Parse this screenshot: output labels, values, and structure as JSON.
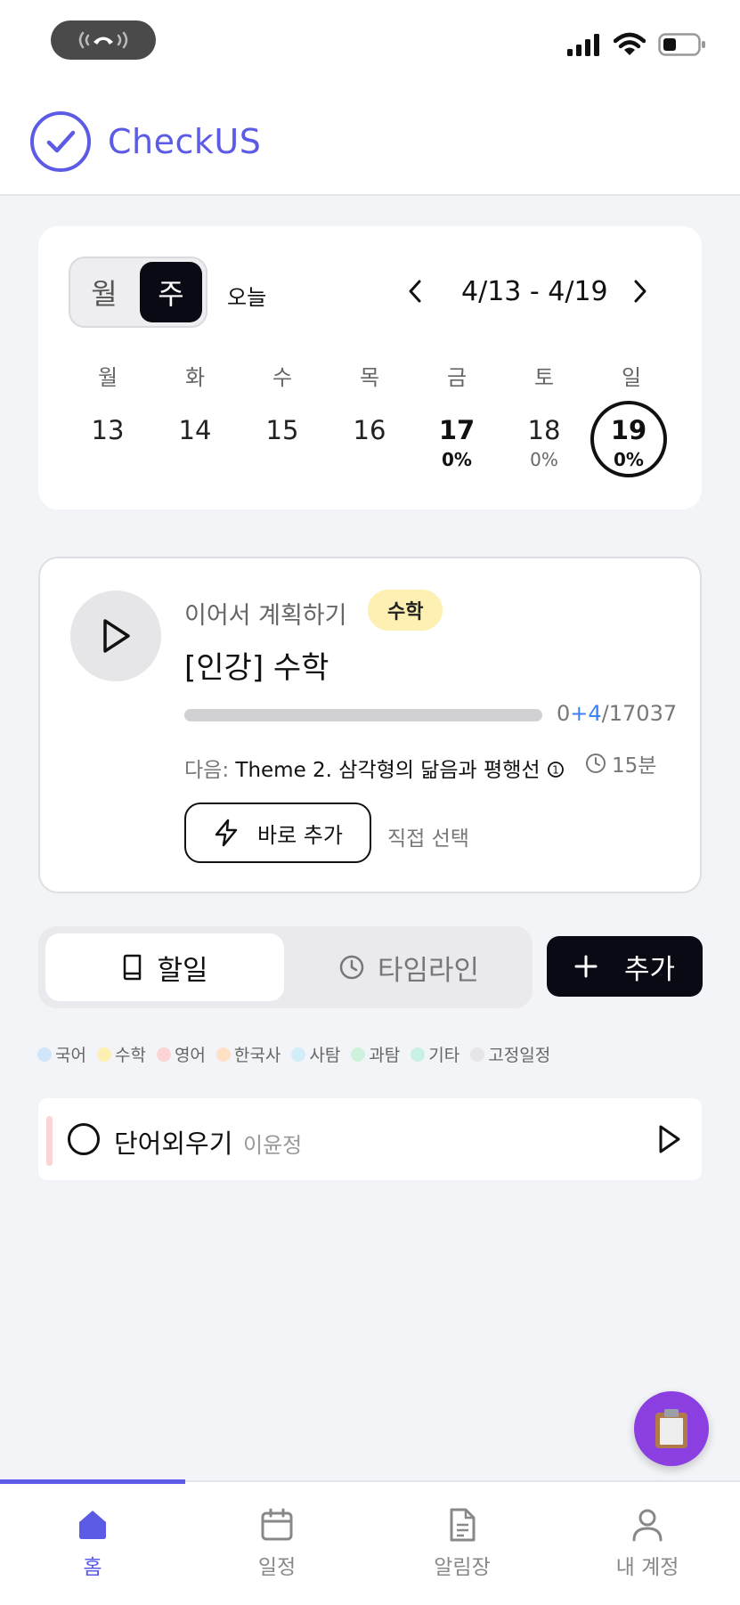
{
  "status_bar": {
    "call_icon": "phone-call-icon",
    "signal_icon": "signal-icon",
    "wifi_icon": "wifi-icon",
    "battery_icon": "battery-icon"
  },
  "header": {
    "logo_icon": "check-circle-icon",
    "title": "CheckUS",
    "brand_color": "#5b5be6"
  },
  "calendar": {
    "view_toggle": {
      "month_label": "월",
      "week_label": "주",
      "selected": "주"
    },
    "today_label": "오늘",
    "range": "4/13 - 4/19",
    "days": [
      {
        "dow": "월",
        "date": "13",
        "pct": ""
      },
      {
        "dow": "화",
        "date": "14",
        "pct": ""
      },
      {
        "dow": "수",
        "date": "15",
        "pct": ""
      },
      {
        "dow": "목",
        "date": "16",
        "pct": ""
      },
      {
        "dow": "금",
        "date": "17",
        "pct": "0%"
      },
      {
        "dow": "토",
        "date": "18",
        "pct": "0%"
      },
      {
        "dow": "일",
        "date": "19",
        "pct": "0%"
      }
    ],
    "selected_day": "19"
  },
  "continue_card": {
    "label": "이어서 계획하기",
    "subject": "수학",
    "title": "[인강] 수학",
    "progress": {
      "done": "0",
      "added": "+4",
      "sep": "/",
      "total": "17037",
      "fraction": 0.0
    },
    "next_prefix": "다음: ",
    "next_title": "Theme 2. 삼각형의 닮음과 평행선",
    "duration": "15분",
    "quick_add_label": "바로 추가",
    "direct_select_label": "직접 선택"
  },
  "tabs": {
    "todo_label": "할일",
    "timeline_label": "타임라인",
    "active": "할일"
  },
  "add_button_label": "추가",
  "legend": [
    {
      "label": "국어",
      "color": "#cfe6fb"
    },
    {
      "label": "수학",
      "color": "#fdf0b2"
    },
    {
      "label": "영어",
      "color": "#fbd5d5"
    },
    {
      "label": "한국사",
      "color": "#fde0c5"
    },
    {
      "label": "사탐",
      "color": "#d3ecfa"
    },
    {
      "label": "과탐",
      "color": "#cdf1dc"
    },
    {
      "label": "기타",
      "color": "#c9f0e6"
    },
    {
      "label": "고정일정",
      "color": "#e6e6ea"
    }
  ],
  "tasks": [
    {
      "title": "단어외우기",
      "owner": "이윤정",
      "color": "#fbd5d5"
    }
  ],
  "fab_icon": "clipboard-icon",
  "bottom_nav": [
    {
      "label": "홈",
      "icon": "home-icon",
      "active": true
    },
    {
      "label": "일정",
      "icon": "calendar-icon",
      "active": false
    },
    {
      "label": "알림장",
      "icon": "document-icon",
      "active": false
    },
    {
      "label": "내 계정",
      "icon": "user-icon",
      "active": false
    }
  ]
}
